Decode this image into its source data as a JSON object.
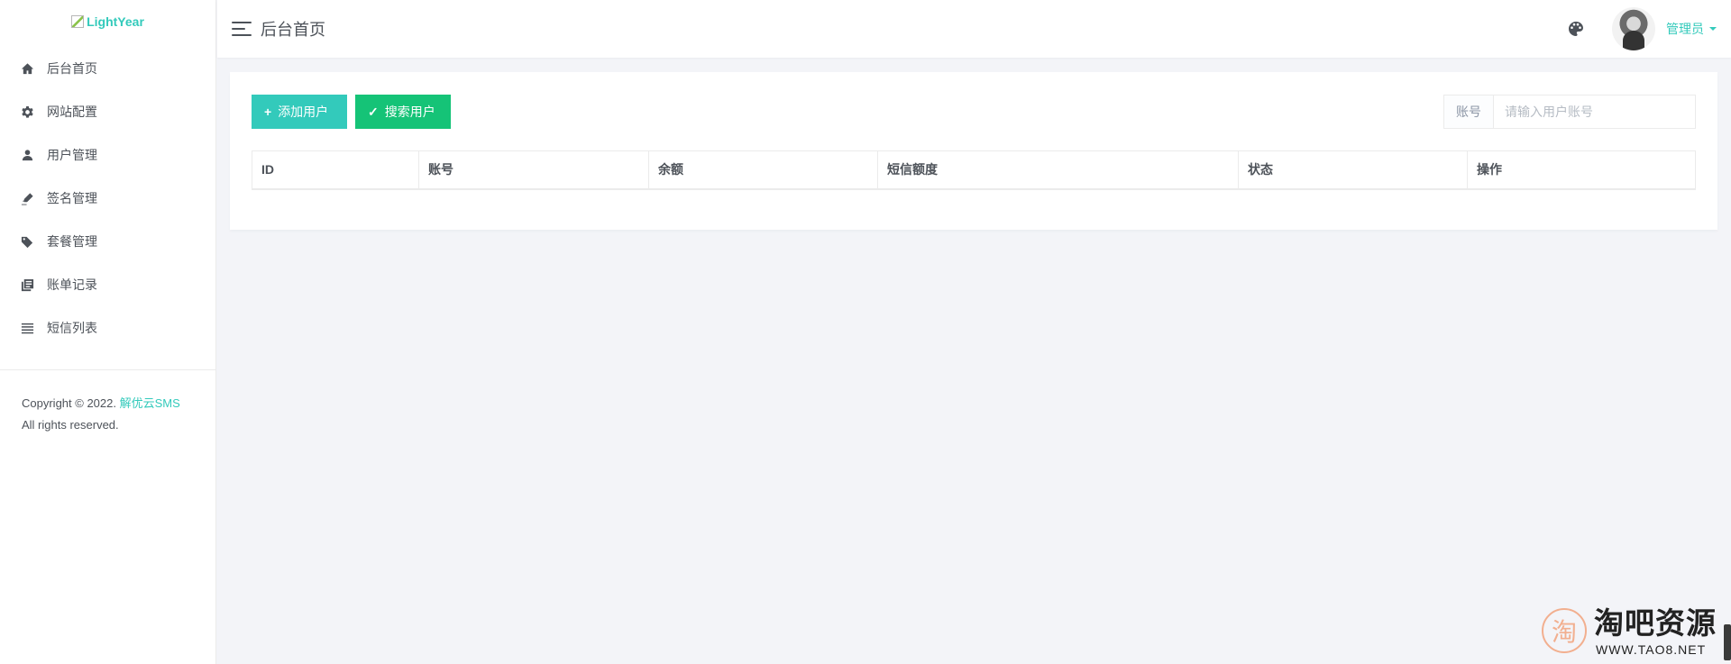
{
  "sidebar": {
    "logo_alt": "LightYear",
    "items": [
      {
        "label": "后台首页",
        "icon": "home-icon"
      },
      {
        "label": "网站配置",
        "icon": "gear-icon"
      },
      {
        "label": "用户管理",
        "icon": "user-icon"
      },
      {
        "label": "签名管理",
        "icon": "signature-icon"
      },
      {
        "label": "套餐管理",
        "icon": "tags-icon"
      },
      {
        "label": "账单记录",
        "icon": "bill-icon"
      },
      {
        "label": "短信列表",
        "icon": "list-icon"
      }
    ],
    "copyright_prefix": "Copyright © 2022. ",
    "copyright_link": "解优云SMS",
    "copyright_suffix": "All rights reserved."
  },
  "header": {
    "title": "后台首页",
    "user_name": "管理员",
    "palette_icon": "palette-icon"
  },
  "toolbar": {
    "add_label": "添加用户",
    "search_label": "搜索用户"
  },
  "search": {
    "addon": "账号",
    "placeholder": "请输入用户账号"
  },
  "table": {
    "columns": [
      "ID",
      "账号",
      "余额",
      "短信额度",
      "状态",
      "操作"
    ]
  },
  "watermark": {
    "char": "淘",
    "title": "淘吧资源",
    "url": "WWW.TAO8.NET"
  },
  "colors": {
    "accent": "#33cabb",
    "success": "#15c377",
    "background": "#f3f4f8"
  }
}
